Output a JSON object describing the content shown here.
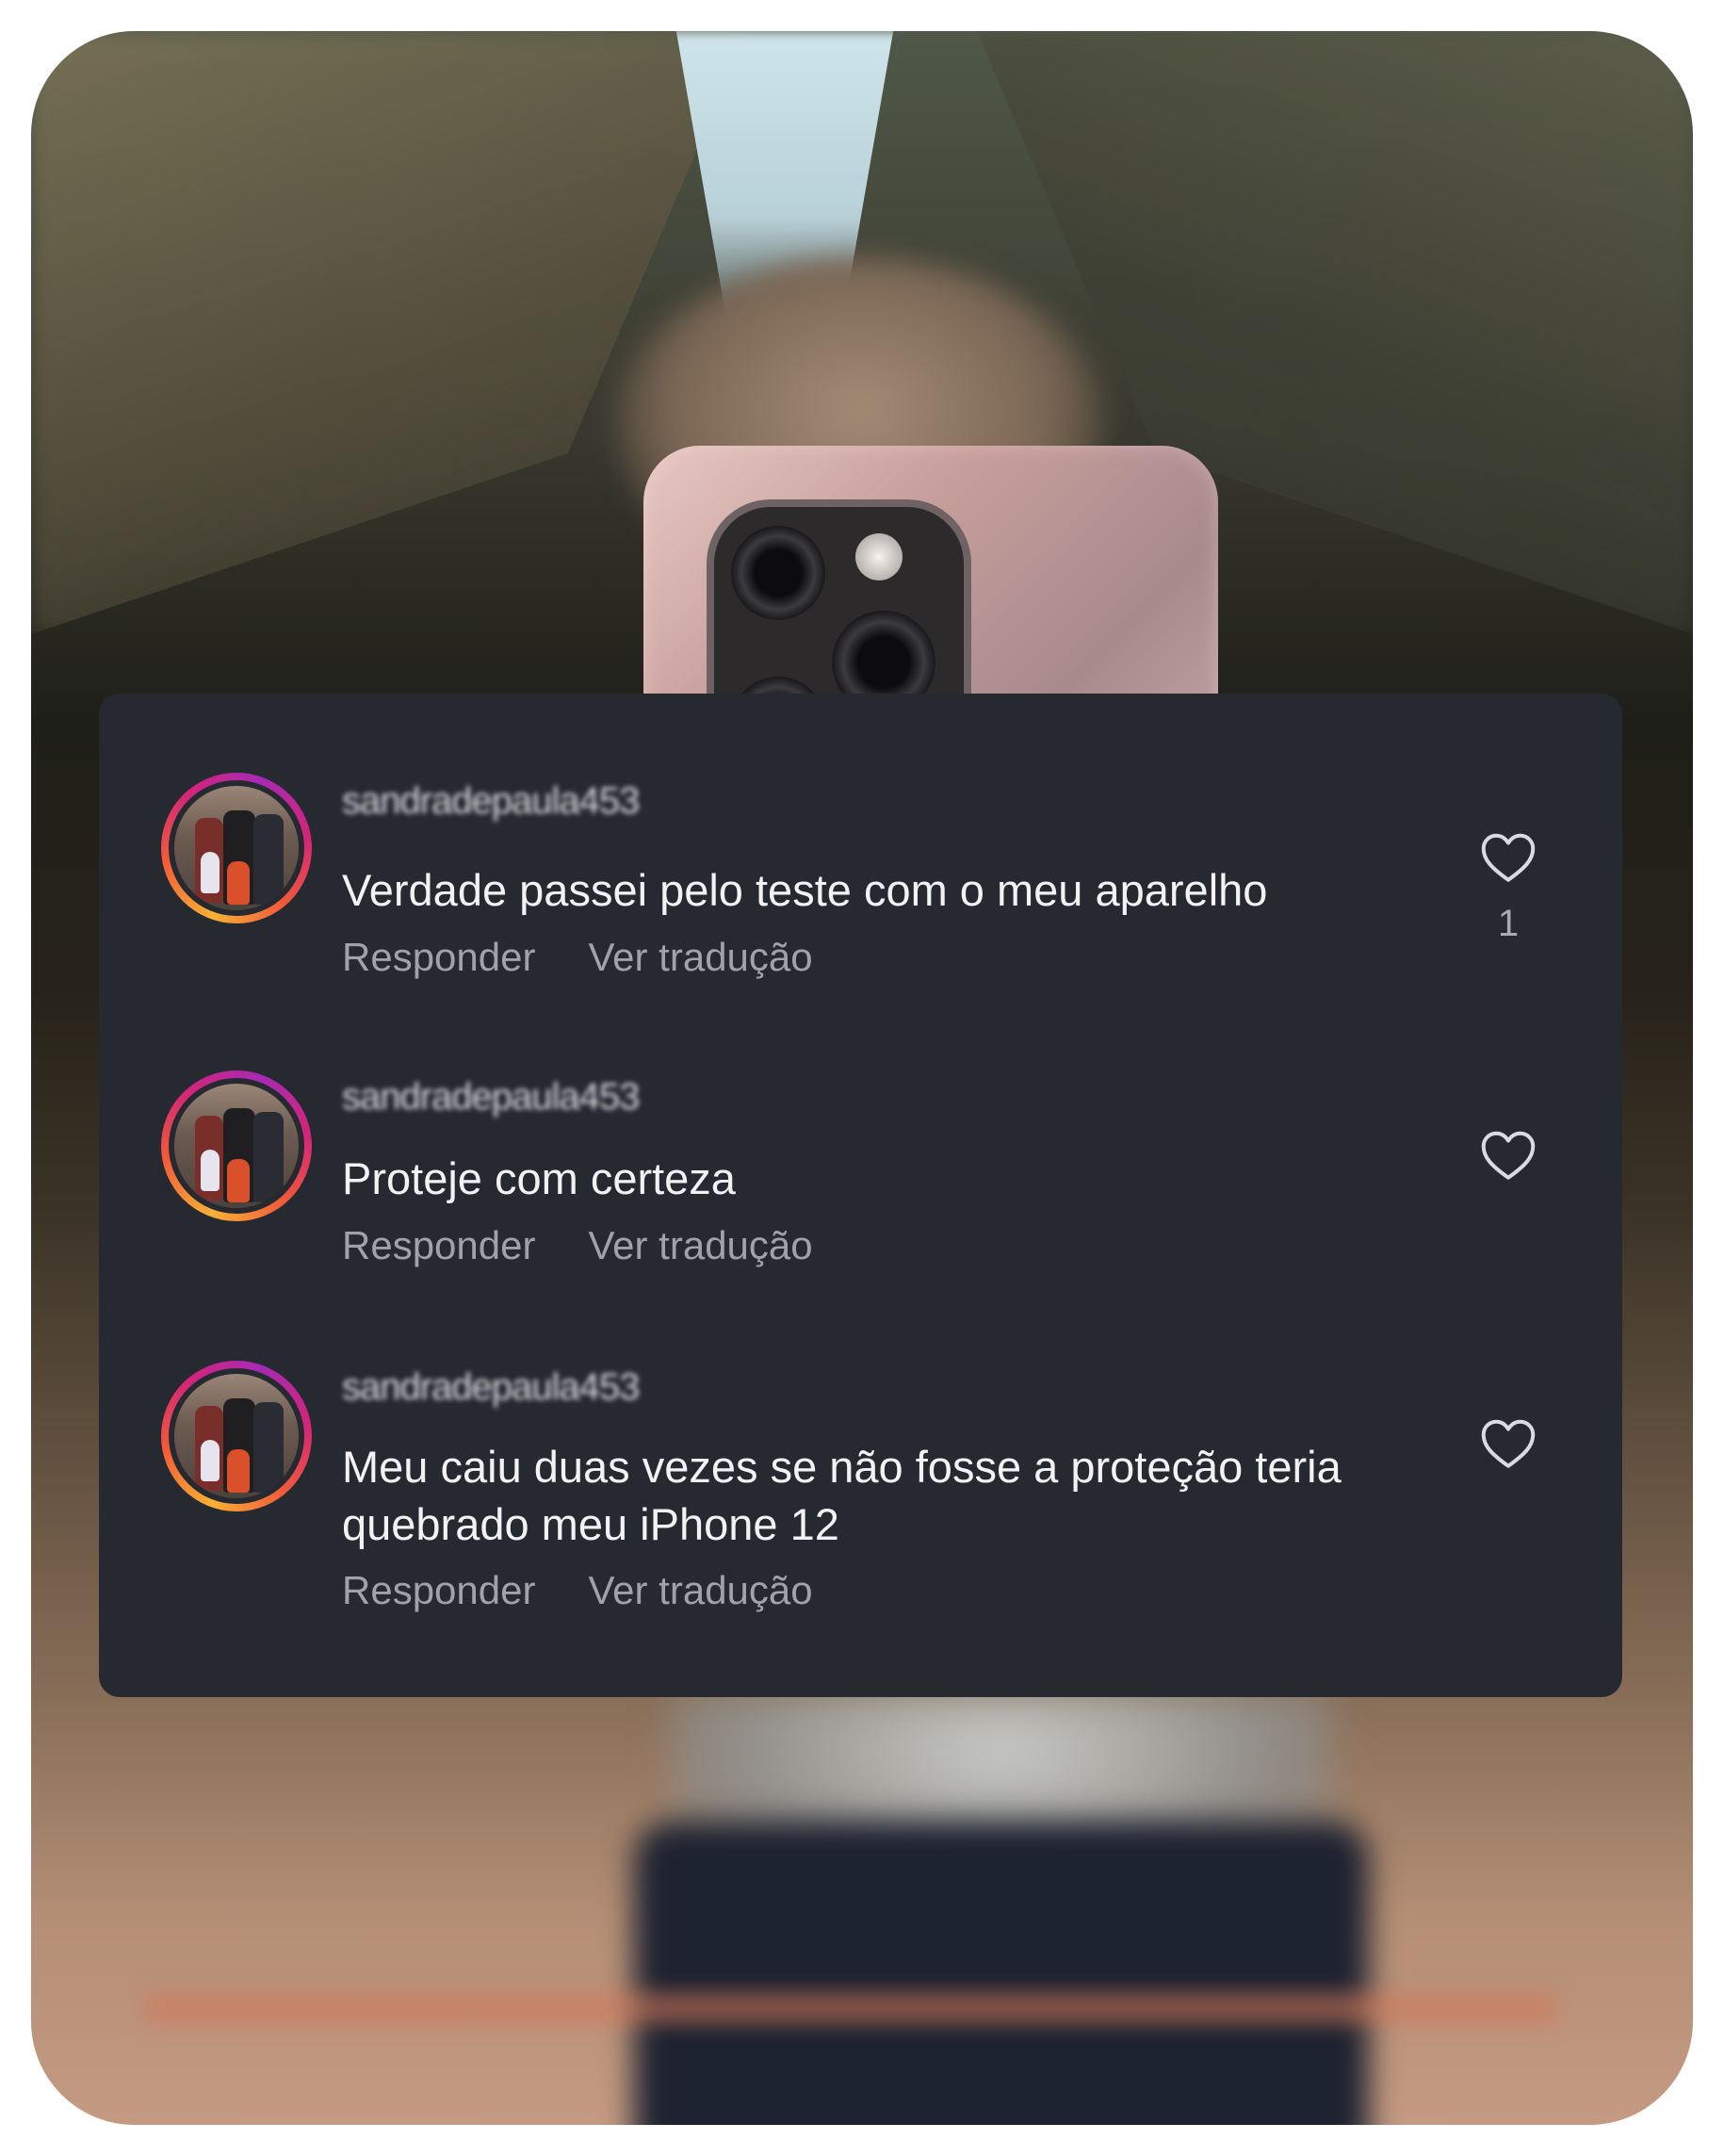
{
  "comments": [
    {
      "username": "sandradepaula453",
      "text": "Verdade passei pelo teste com o meu aparelho",
      "reply_label": "Responder",
      "translate_label": "Ver tradução",
      "likes": "1"
    },
    {
      "username": "sandradepaula453",
      "text": "Proteje com certeza",
      "reply_label": "Responder",
      "translate_label": "Ver tradução",
      "likes": ""
    },
    {
      "username": "sandradepaula453",
      "text": "Meu caiu duas vezes se não fosse a proteção teria quebrado meu iPhone 12",
      "reply_label": "Responder",
      "translate_label": "Ver tradução",
      "likes": ""
    }
  ],
  "icons": {
    "like": "heart-icon",
    "avatar": "avatar"
  },
  "colors": {
    "card_background": "#262930",
    "comment_text": "#f2f2f4",
    "action_text": "#9fa2aa",
    "avatar_ring": [
      "#f7b135",
      "#f15a39",
      "#d3247a",
      "#a52bb4"
    ]
  }
}
